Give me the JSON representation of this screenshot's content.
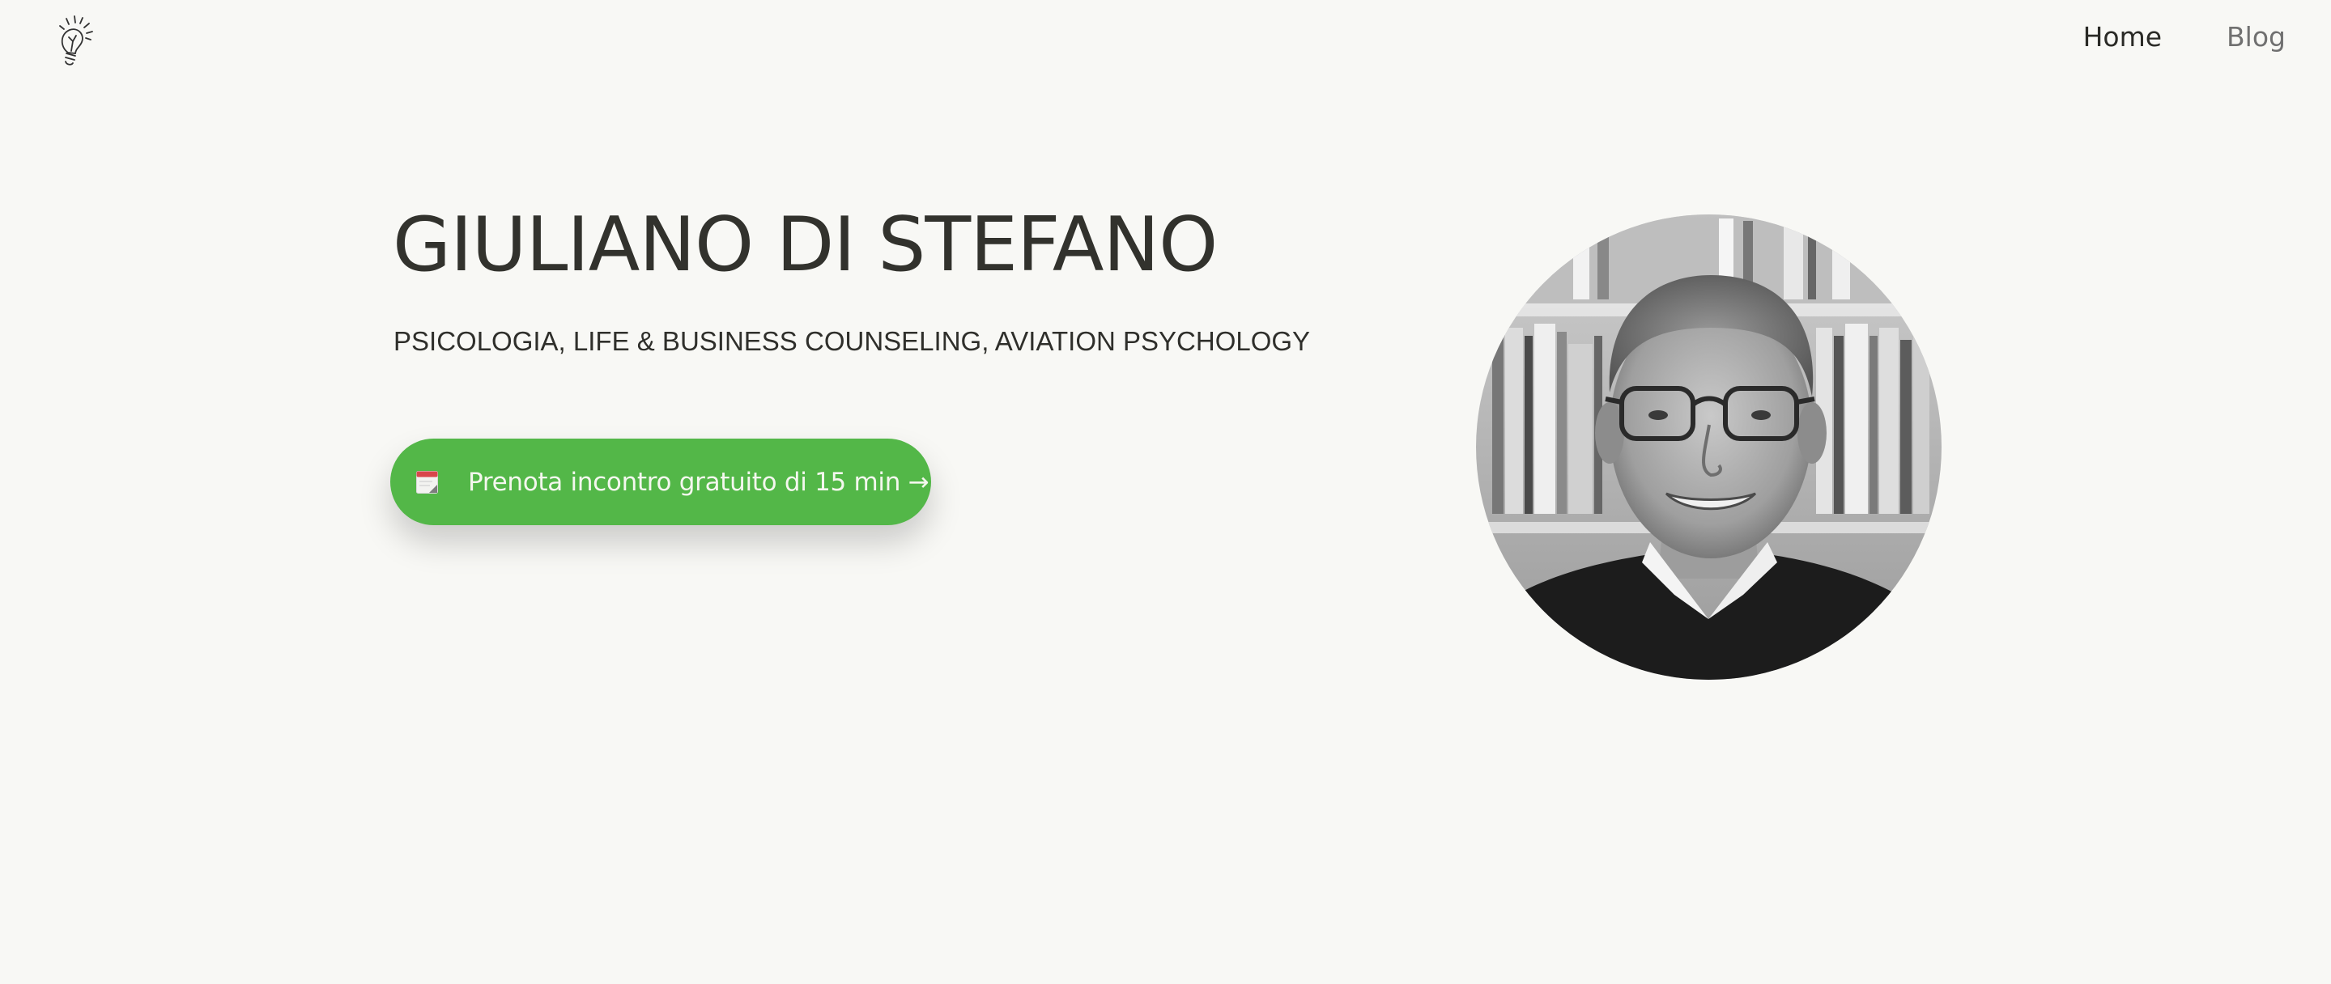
{
  "header": {
    "logo_icon": "lightbulb-icon",
    "nav": [
      {
        "label": "Home"
      },
      {
        "label": "Blog"
      }
    ]
  },
  "hero": {
    "title": "GIULIANO DI STEFANO",
    "subtitle": "PSICOLOGIA, LIFE & BUSINESS COUNSELING, AVIATION PSYCHOLOGY",
    "cta": {
      "icon": "calendar-icon",
      "label": "Prenota incontro gratuito di 15 min →"
    },
    "portrait_icon": "portrait-photo"
  },
  "colors": {
    "background": "#f8f8f5",
    "accent": "#53b748",
    "text": "#353530"
  }
}
